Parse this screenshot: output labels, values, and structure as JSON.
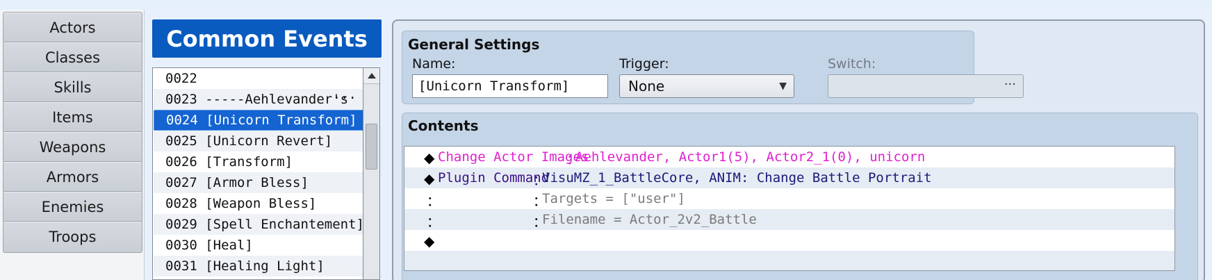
{
  "nav": {
    "items": [
      "Actors",
      "Classes",
      "Skills",
      "Items",
      "Weapons",
      "Armors",
      "Enemies",
      "Troops"
    ]
  },
  "common_events": {
    "title": "Common Events",
    "rows": [
      {
        "id": "0022",
        "name": ""
      },
      {
        "id": "0023",
        "name": "-----Aehlevander's"
      },
      {
        "id": "0024",
        "name": "[Unicorn Transform]"
      },
      {
        "id": "0025",
        "name": "[Unicorn Revert]"
      },
      {
        "id": "0026",
        "name": "[Transform]"
      },
      {
        "id": "0027",
        "name": "[Armor Bless]"
      },
      {
        "id": "0028",
        "name": "[Weapon Bless]"
      },
      {
        "id": "0029",
        "name": "[Spell Enchantement]"
      },
      {
        "id": "0030",
        "name": "[Heal]"
      },
      {
        "id": "0031",
        "name": "[Healing Light]"
      }
    ],
    "truncation": "···"
  },
  "general": {
    "title": "General Settings",
    "name_label": "Name:",
    "name_value": "[Unicorn Transform]",
    "trigger_label": "Trigger:",
    "trigger_value": "None",
    "switch_label": "Switch:",
    "switch_dots": "···"
  },
  "contents": {
    "title": "Contents",
    "commands": [
      {
        "name": "Change Actor Images",
        "sep": "：",
        "args": "Aehlevander, Actor1(5), Actor2_1(0), unicorn"
      },
      {
        "name": "Plugin Command",
        "sep": "：",
        "args": "VisuMZ_1_BattleCore, ANIM: Change Battle Portrait"
      },
      {
        "lead": "：",
        "sep": "：",
        "args": "Targets = [\"user\"]"
      },
      {
        "lead": "：",
        "sep": "：",
        "args": "Filename = Actor_2v2_Battle"
      }
    ],
    "diamond": "◆"
  }
}
